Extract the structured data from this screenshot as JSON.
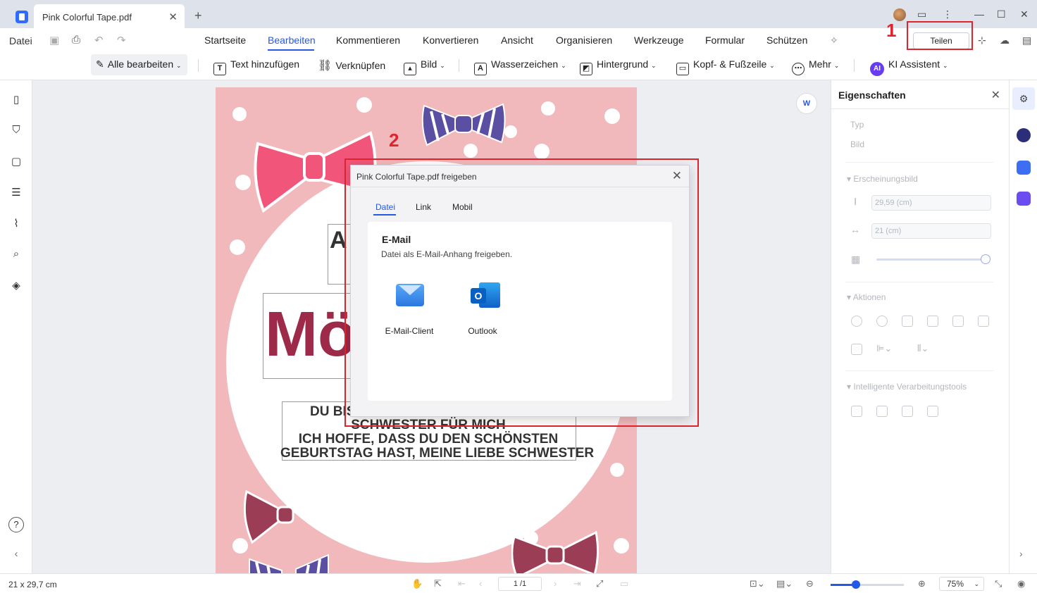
{
  "titlebar": {
    "tab_title": "Pink Colorful Tape.pdf",
    "close_glyph": "✕",
    "new_tab_glyph": "+"
  },
  "menu": {
    "file": "Datei",
    "items": [
      "Startseite",
      "Bearbeiten",
      "Kommentieren",
      "Konvertieren",
      "Ansicht",
      "Organisieren",
      "Werkzeuge",
      "Formular",
      "Schützen"
    ],
    "active": "Bearbeiten",
    "share_button": "Teilen"
  },
  "annotations": {
    "step1": "1",
    "step2": "2",
    "color": "#e0242e"
  },
  "toolbar": {
    "edit_all": "Alle bearbeiten",
    "add_text": "Text hinzufügen",
    "link": "Verknüpfen",
    "image": "Bild",
    "watermark": "Wasserzeichen",
    "background": "Hintergrund",
    "header_footer": "Kopf- & Fußzeile",
    "more": "Mehr",
    "ai_badge": "AI",
    "ai_assistant": "KI Assistent"
  },
  "page_content": {
    "title_partial": "A",
    "name_partial": "Mö",
    "line1": "DU BIS",
    "line2": "SCHWESTER FÜR MICH",
    "line3": "ICH HOFFE, DASS DU DEN SCHÖNSTEN",
    "line4": "GEBURTSTAG HAST, MEINE LIEBE SCHWESTER"
  },
  "dialog": {
    "title": "Pink Colorful Tape.pdf freigeben",
    "tabs": [
      "Datei",
      "Link",
      "Mobil"
    ],
    "active_tab": "Datei",
    "section_title": "E-Mail",
    "section_sub": "Datei als E-Mail-Anhang freigeben.",
    "options": [
      "E-Mail-Client",
      "Outlook"
    ]
  },
  "properties": {
    "title": "Eigenschaften",
    "type_label": "Typ",
    "type_value": "Bild",
    "appearance": "Erscheinungsbild",
    "height": "29,59 (cm)",
    "width": "21 (cm)",
    "actions": "Aktionen",
    "smart_tools": "Intelligente Verarbeitungstools",
    "opacity_level": 1.0
  },
  "statusbar": {
    "page_size": "21 x 29,7 cm",
    "page_indicator": "1 /1",
    "zoom": "75%",
    "zoom_level": 0.35
  },
  "colors": {
    "accent": "#2458e6",
    "page_bg": "#f1b9bc",
    "name_color": "#9c2a48"
  }
}
